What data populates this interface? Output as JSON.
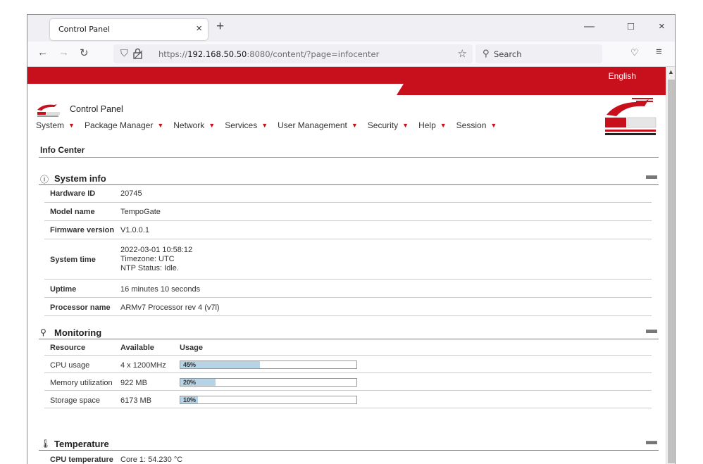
{
  "browser": {
    "tab_title": "Control Panel",
    "tab_close": "×",
    "new_tab": "+",
    "url_prefix": "https://",
    "url_host": "192.168.50.50",
    "url_rest": ":8080/content/?page=infocenter",
    "search_placeholder": "Search",
    "window_min": "—",
    "window_max": "□",
    "window_close": "×"
  },
  "header": {
    "language": "English",
    "app_title": "Control Panel",
    "brand_color": "#c8101c"
  },
  "menu": [
    {
      "label": "System"
    },
    {
      "label": "Package Manager"
    },
    {
      "label": "Network"
    },
    {
      "label": "Services"
    },
    {
      "label": "User Management"
    },
    {
      "label": "Security"
    },
    {
      "label": "Help"
    },
    {
      "label": "Session"
    }
  ],
  "page_title": "Info Center",
  "system_info": {
    "title": "System info",
    "rows": [
      {
        "label": "Hardware ID",
        "value": "20745"
      },
      {
        "label": "Model name",
        "value": "TempoGate"
      },
      {
        "label": "Firmware version",
        "value": "V1.0.0.1"
      },
      {
        "label": "System time",
        "value_lines": [
          "2022-03-01 10:58:12",
          "Timezone: UTC",
          "NTP Status: Idle."
        ]
      },
      {
        "label": "Uptime",
        "value": "16 minutes 10 seconds"
      },
      {
        "label": "Processor name",
        "value": "ARMv7 Processor rev 4 (v7l)"
      }
    ]
  },
  "monitoring": {
    "title": "Monitoring",
    "headers": {
      "resource": "Resource",
      "available": "Available",
      "usage": "Usage"
    },
    "rows": [
      {
        "resource": "CPU usage",
        "available": "4 x 1200MHz",
        "usage_label": "45%",
        "usage": 45
      },
      {
        "resource": "Memory utilization",
        "available": "922 MB",
        "usage_label": "20%",
        "usage": 20
      },
      {
        "resource": "Storage space",
        "available": "6173 MB",
        "usage_label": "10%",
        "usage": 10
      }
    ]
  },
  "temperature": {
    "title": "Temperature",
    "rows": [
      {
        "label": "CPU temperature",
        "value": "Core 1: 54.230 °C"
      }
    ]
  }
}
